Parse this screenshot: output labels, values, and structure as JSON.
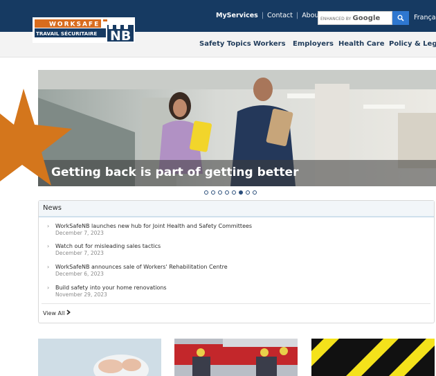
{
  "header": {
    "logo_top": "WORKSAFE",
    "logo_bottom": "TRAVAIL SÉCURITAIRE",
    "logo_nb": "NB",
    "myservices_prefix": "My",
    "myservices_rest": "Services",
    "contact": "Contact",
    "about": "About Us",
    "search_prefix": "ENHANCED BY",
    "search_brand": "Google",
    "search_button_icon": "search-icon",
    "language": "Français"
  },
  "nav": [
    {
      "label": "Safety Topics"
    },
    {
      "label": "Workers"
    },
    {
      "label": "Employers"
    },
    {
      "label": "Health Care"
    },
    {
      "label": "Policy & Legal"
    }
  ],
  "hero": {
    "caption": "Getting back is part of getting better",
    "slide_count": 8,
    "active_slide": 6
  },
  "news": {
    "heading": "News",
    "items": [
      {
        "title": "WorkSafeNB launches new hub for Joint Health and Safety Committees",
        "date": "December 7, 2023"
      },
      {
        "title": "Watch out for misleading sales tactics",
        "date": "December 7, 2023"
      },
      {
        "title": "WorkSafeNB announces sale of Workers' Rehabilitation Centre",
        "date": "December 6, 2023"
      },
      {
        "title": "Build safety into your home renovations",
        "date": "November 29, 2023"
      }
    ],
    "view_all": "View All",
    "view_all_icon": "chevron-right-icon"
  },
  "colors": {
    "topbar": "#163a62",
    "logo_orange": "#d86c1e",
    "search_button": "#2e77d0",
    "star": "#d4761c"
  }
}
